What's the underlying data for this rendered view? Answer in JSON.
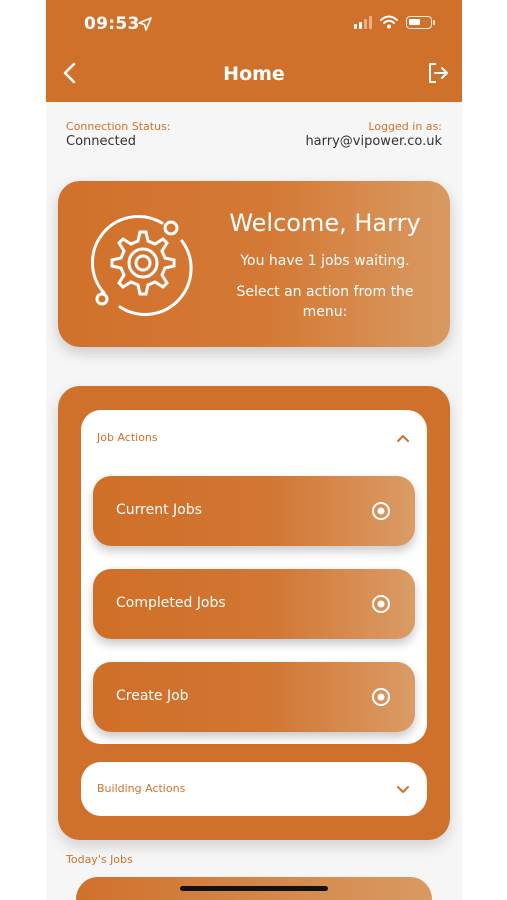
{
  "status_bar": {
    "time": "09:53"
  },
  "nav": {
    "title": "Home"
  },
  "connection": {
    "status_label": "Connection Status:",
    "status_value": "Connected",
    "login_label": "Logged in as:",
    "login_value": "harry@vipower.co.uk"
  },
  "welcome": {
    "title": "Welcome, Harry",
    "jobs_waiting": "You have 1 jobs waiting.",
    "prompt": "Select an action from the menu:"
  },
  "job_actions": {
    "title": "Job Actions",
    "expanded": true,
    "buttons": [
      {
        "label": "Current Jobs"
      },
      {
        "label": "Completed Jobs"
      },
      {
        "label": "Create Job"
      }
    ]
  },
  "building_actions": {
    "title": "Building Actions",
    "expanded": false
  },
  "todays_jobs": {
    "label": "Today's Jobs"
  },
  "colors": {
    "primary": "#d0712b",
    "background": "#f6f6f6",
    "card": "#ffffff"
  },
  "icons": [
    "location-arrow-icon",
    "signal-icon",
    "wifi-icon",
    "battery-icon",
    "back-chevron-icon",
    "logout-icon",
    "gear-icon",
    "chevron-up-icon",
    "radio-target-icon",
    "chevron-down-icon"
  ]
}
